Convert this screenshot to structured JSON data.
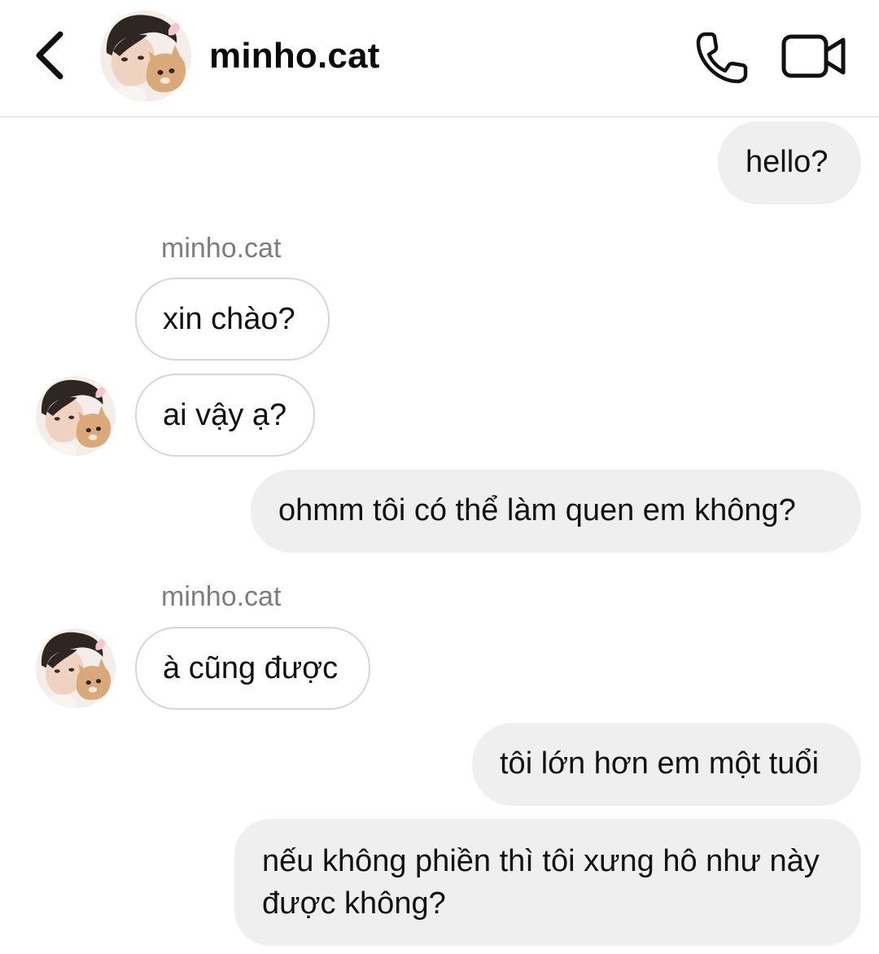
{
  "header": {
    "username": "minho.cat",
    "back_icon": "chevron-left-icon",
    "call_icon": "phone-icon",
    "video_icon": "video-camera-icon"
  },
  "messages": [
    {
      "direction": "outgoing",
      "text": "hello?"
    },
    {
      "direction": "incoming",
      "sender": "minho.cat",
      "text": "xin chào?"
    },
    {
      "direction": "incoming",
      "text": "ai vậy ạ?"
    },
    {
      "direction": "outgoing",
      "text": "ohmm tôi có thể làm quen em không?"
    },
    {
      "direction": "incoming",
      "sender": "minho.cat",
      "text": "à cũng được"
    },
    {
      "direction": "outgoing",
      "text": "tôi lớn hơn em một tuổi"
    },
    {
      "direction": "outgoing",
      "text": "nếu không phiền thì tôi xưng hô như này được không?"
    }
  ]
}
